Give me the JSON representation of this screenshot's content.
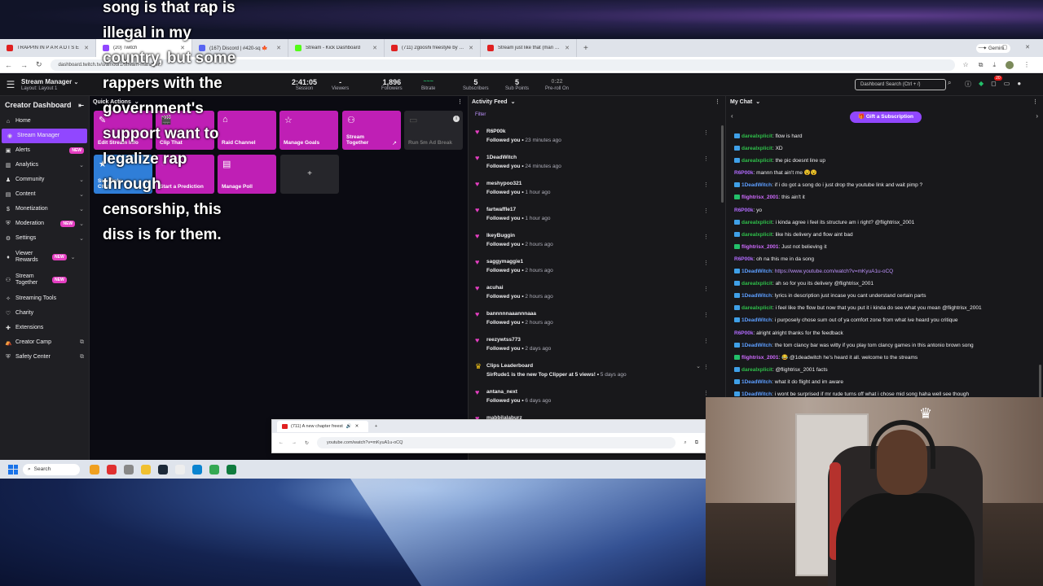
{
  "lyrics": [
    "song is that rap is",
    "illegal in my",
    "country, but some",
    "rappers with the",
    "government's",
    "support want to",
    "legalize rap",
    "through",
    "censorship, this",
    "diss is for them."
  ],
  "browser": {
    "tabs": [
      {
        "title": "TRAPPIN IN P A R A D I S E",
        "color": "#e02020"
      },
      {
        "title": "(20) Twitch",
        "color": "#9147ff",
        "active": true
      },
      {
        "title": "(167) Discord | #420-sq 🍁",
        "color": "#5865f2"
      },
      {
        "title": "Stream - Kick Dashboard",
        "color": "#53fc18"
      },
      {
        "title": "(711) 2gooshi freestyle by uss",
        "color": "#e02020"
      },
      {
        "title": "Stream just like that (man - 100",
        "color": "#e02020"
      }
    ],
    "new_tab": "+",
    "gemini": "✦ Gemini",
    "url": "dashboard.twitch.tv/u/amour1/stream-manager",
    "icons": {
      "back": "←",
      "forward": "→",
      "reload": "↻",
      "star": "☆"
    }
  },
  "topbar": {
    "title": "Stream Manager",
    "layout": "Layout: Layout 1",
    "stats": [
      {
        "value": "2:41:05",
        "label": "Session"
      },
      {
        "value": "-",
        "label": "Viewers"
      },
      {
        "value": "1,896",
        "label": "Followers"
      },
      {
        "value": "~~~",
        "label": "Bitrate"
      },
      {
        "value": "5",
        "label": "Subscribers"
      },
      {
        "value": "5",
        "label": "Sub Points"
      },
      {
        "value": "0:22",
        "label": "Pre-roll On"
      }
    ],
    "search_placeholder": "Dashboard Search (Ctrl + /)",
    "notif_count": "20"
  },
  "sidebar": {
    "title": "Creator Dashboard",
    "items": [
      {
        "label": "Home",
        "icon": "⌂"
      },
      {
        "label": "Stream Manager",
        "icon": "◉",
        "active": true
      },
      {
        "label": "Alerts",
        "icon": "▣",
        "badge": "NEW"
      },
      {
        "label": "Analytics",
        "icon": "▥",
        "chev": "⌄"
      },
      {
        "label": "Community",
        "icon": "♟",
        "chev": "⌄"
      },
      {
        "label": "Content",
        "icon": "▤",
        "chev": "⌄"
      },
      {
        "label": "Monetization",
        "icon": "$",
        "chev": "⌄"
      },
      {
        "label": "Moderation",
        "icon": "⛨",
        "badge": "NEW",
        "chev": "⌄"
      },
      {
        "label": "Settings",
        "icon": "⚙",
        "chev": "⌄"
      },
      {
        "label": "Viewer Rewards",
        "icon": "♦",
        "badge": "NEW",
        "chev": "⌄"
      },
      {
        "label": "Stream Together",
        "icon": "⚇",
        "badge": "NEW"
      },
      {
        "label": "Streaming Tools",
        "icon": "✧"
      },
      {
        "label": "Charity",
        "icon": "♡"
      },
      {
        "label": "Extensions",
        "icon": "✚"
      },
      {
        "label": "Creator Camp",
        "icon": "⛺",
        "ext": "⧉"
      },
      {
        "label": "Safety Center",
        "icon": "⛨",
        "ext": "⧉"
      }
    ]
  },
  "quick_actions": {
    "title": "Quick Actions",
    "tiles": [
      {
        "label": "Edit Stream Info",
        "icon": "✎"
      },
      {
        "label": "Clip That",
        "icon": "🎬"
      },
      {
        "label": "Raid Channel",
        "icon": "⌂"
      },
      {
        "label": "Manage Goals",
        "icon": "☆"
      },
      {
        "label": "Stream Together",
        "icon": "⚇",
        "ext": "↗"
      },
      {
        "label": "Run 5m Ad Break",
        "icon": "▭"
      },
      {
        "label": "Sub-Only Chat",
        "icon": "★"
      },
      {
        "label": "Start a Prediction",
        "icon": "◔"
      },
      {
        "label": "Manage Poll",
        "icon": "▤"
      }
    ],
    "add": "+"
  },
  "activity_feed": {
    "title": "Activity Feed",
    "filter": "Filter",
    "items": [
      {
        "name": "R6P00k",
        "desc": "Followed you",
        "time": "23 minutes ago"
      },
      {
        "name": "1DeadWitch",
        "desc": "Followed you",
        "time": "24 minutes ago"
      },
      {
        "name": "meshypoo321",
        "desc": "Followed you",
        "time": "1 hour ago"
      },
      {
        "name": "fartwaffle17",
        "desc": "Followed you",
        "time": "1 hour ago"
      },
      {
        "name": "lkeyBuggin",
        "desc": "Followed you",
        "time": "2 hours ago"
      },
      {
        "name": "saggymaggie1",
        "desc": "Followed you",
        "time": "2 hours ago"
      },
      {
        "name": "acuhai",
        "desc": "Followed you",
        "time": "2 hours ago"
      },
      {
        "name": "bannnnnaaannnaaa",
        "desc": "Followed you",
        "time": "2 hours ago"
      },
      {
        "name": "reezywtss773",
        "desc": "Followed you",
        "time": "2 days ago"
      }
    ],
    "clips": {
      "name": "Clips Leaderboard",
      "desc": "SirRude1 is the new Top Clipper at 5 views!",
      "time": "5 days ago"
    },
    "after": [
      {
        "name": "antana_next",
        "desc": "Followed you",
        "time": "6 days ago"
      },
      {
        "name": "mabbilalaburz",
        "desc": "",
        "time": ""
      }
    ]
  },
  "chat": {
    "title": "My Chat",
    "gift_label": "🎁 Gift a Subscription",
    "messages": [
      {
        "user": "darealxplicit",
        "color": "c-green",
        "text": "flow is hard"
      },
      {
        "user": "darealxplicit",
        "color": "c-green",
        "text": "XD"
      },
      {
        "user": "darealxplicit",
        "color": "c-green",
        "text": "the pic doesnt line up"
      },
      {
        "user": "R6P00k",
        "color": "c-purple",
        "text": "mannn that ain't me 😵😵",
        "nobadge": true
      },
      {
        "user": "1DeadWitch",
        "color": "c-blue",
        "text": "if i do got a song do i just drop the youtube link and wait pimp ?"
      },
      {
        "user": "flightrisx_2001",
        "color": "c-pink",
        "text": "this ain't it",
        "green": true
      },
      {
        "user": "R6P00k",
        "color": "c-purple",
        "text": "yo",
        "nobadge": true
      },
      {
        "user": "darealxplicit",
        "color": "c-green",
        "text": "i kinda agree i feel its structure am i right? @flightrisx_2001"
      },
      {
        "user": "darealxplicit",
        "color": "c-green",
        "text": "like his delivery and flow aint bad"
      },
      {
        "user": "flightrisx_2001",
        "color": "c-pink",
        "text": "Just not believing it",
        "green": true
      },
      {
        "user": "R6P00k",
        "color": "c-purple",
        "text": "oh na this me in da song",
        "nobadge": true
      },
      {
        "user": "1DeadWitch",
        "color": "c-blue",
        "text": "https://www.youtube.com/watch?v=mKyuA1u-oCQ",
        "link": true
      },
      {
        "user": "darealxplicit",
        "color": "c-green",
        "text": "ah so for you its delivery @flightrisx_2001"
      },
      {
        "user": "1DeadWitch",
        "color": "c-blue",
        "text": "lyrics in description just incase you cant understand certain parts"
      },
      {
        "user": "darealxplicit",
        "color": "c-green",
        "text": "i feel like the flow but now that you put it i kinda do see what you mean @flightrisx_2001"
      },
      {
        "user": "1DeadWitch",
        "color": "c-blue",
        "text": "i purposely chose sum out of ya comfort zone from what ive heard you critique"
      },
      {
        "user": "R6P00k",
        "color": "c-purple",
        "text": "alright alright thanks for the feedback",
        "nobadge": true
      },
      {
        "user": "1DeadWitch",
        "color": "c-blue",
        "text": "the tom clancy bar was witty if you play tom clancy games in this antonio brown song"
      },
      {
        "user": "flightrisx_2001",
        "color": "c-pink",
        "text": "😂 @1deadwitch he's heard it all. welcome to the streams",
        "green": true
      },
      {
        "user": "darealxplicit",
        "color": "c-green",
        "text": "@flightrisx_2001 facts"
      },
      {
        "user": "1DeadWitch",
        "color": "c-blue",
        "text": "what it do flight and im aware"
      },
      {
        "user": "1DeadWitch",
        "color": "c-blue",
        "text": "i wont be surprised if mr rude turns off what i chose mid song haha well see though"
      }
    ]
  },
  "mini_browser": {
    "tab_title": "(711) A new chapter freest",
    "url": "youtube.com/watch?v=mKyuA1u-oCQ"
  },
  "taskbar": {
    "search": "Search",
    "apps": [
      "#f0a020",
      "#e03030",
      "#888888",
      "#f0c030",
      "#1b2838",
      "#eeeeee",
      "#0a84d0",
      "#34a853",
      "#0f7b3e"
    ]
  }
}
